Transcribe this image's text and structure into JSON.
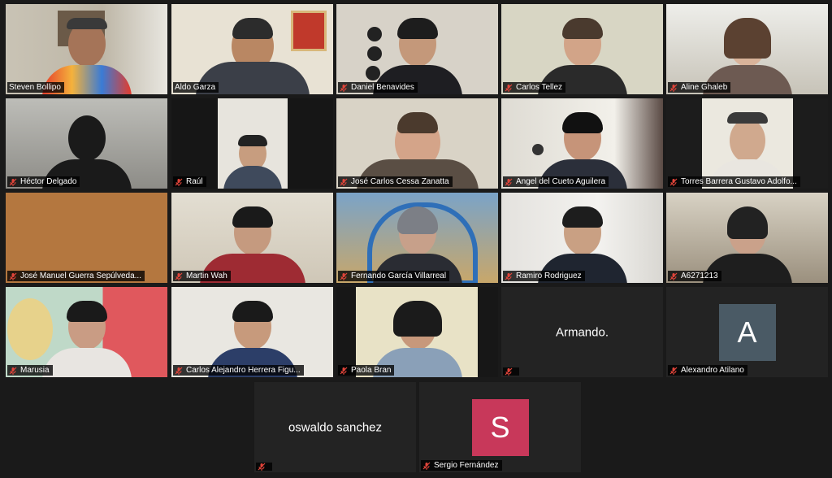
{
  "participants": [
    {
      "name": "Steven Bollipo"
    },
    {
      "name": "Aldo Garza"
    },
    {
      "name": "Daniel Benavides"
    },
    {
      "name": "Carlos Tellez"
    },
    {
      "name": "Aline Ghaleb"
    },
    {
      "name": "Héctor Delgado"
    },
    {
      "name": "Raúl"
    },
    {
      "name": "José Carlos Cessa Zanatta"
    },
    {
      "name": "Angel del Cueto Aguilera"
    },
    {
      "name": "Torres Barrera Gustavo Adolfo..."
    },
    {
      "name": "José Manuel Guerra Sepúlveda..."
    },
    {
      "name": "Martin Wah"
    },
    {
      "name": "Fernando García Villarreal"
    },
    {
      "name": "Ramiro Rodriguez"
    },
    {
      "name": "A6271213"
    },
    {
      "name": "Marusia"
    },
    {
      "name": "Carlos Alejandro Herrera Figu..."
    },
    {
      "name": "Paola Bran"
    },
    {
      "name": "Armando.",
      "display_name": "Armando."
    },
    {
      "name": "Alexandro Atilano",
      "avatar_letter": "A",
      "avatar_color": "#4a5a65"
    },
    {
      "name": "oswaldo sanchez",
      "display_name": "oswaldo sanchez"
    },
    {
      "name": "Sergio Fernández",
      "avatar_letter": "S",
      "avatar_color": "#c8385a"
    }
  ],
  "active_speaker_color": "#c9e25d",
  "muted_icon_color": "#e0443a"
}
